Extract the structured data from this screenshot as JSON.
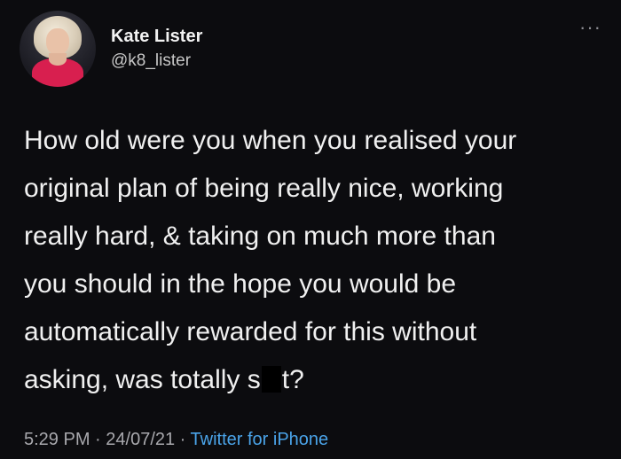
{
  "author": {
    "display_name": "Kate Lister",
    "handle": "@k8_lister"
  },
  "menu_icon": "more-horizontal-icon",
  "tweet": {
    "lines": [
      "How old were you when you realised your",
      "original plan of being really nice, working",
      "really hard, & taking on much more than",
      "you should in the hope you would be",
      "automatically rewarded for this without"
    ],
    "last_line_start": "asking, was totally s",
    "last_line_end": "t?"
  },
  "meta": {
    "time": "5:29 PM",
    "separator1": " · ",
    "date": "24/07/21",
    "separator2": " · ",
    "source": "Twitter for iPhone"
  },
  "colors": {
    "background": "#0c0c0f",
    "text": "#f0f0f0",
    "muted": "#a8a8ad",
    "link": "#4aa3e8"
  }
}
